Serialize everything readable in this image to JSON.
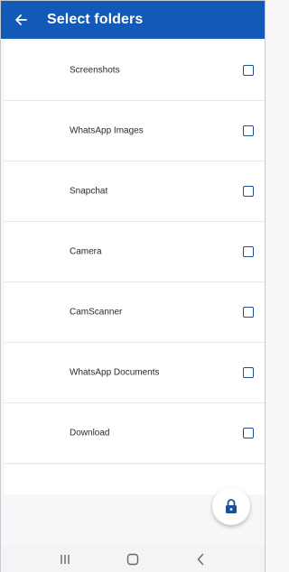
{
  "appbar": {
    "title": "Select folders",
    "back_icon": "arrow-left-icon",
    "background": "#1259b8"
  },
  "folders": [
    {
      "label": "Screenshots",
      "checked": false
    },
    {
      "label": "WhatsApp Images",
      "checked": false
    },
    {
      "label": "Snapchat",
      "checked": false
    },
    {
      "label": "Camera",
      "checked": false
    },
    {
      "label": "CamScanner",
      "checked": false
    },
    {
      "label": "WhatsApp Documents",
      "checked": false
    },
    {
      "label": "Download",
      "checked": false
    }
  ],
  "fab": {
    "icon": "lock-icon",
    "color": "#1f4f96"
  },
  "navbar": {
    "buttons": [
      "recents-icon",
      "home-icon",
      "back-nav-icon"
    ]
  }
}
